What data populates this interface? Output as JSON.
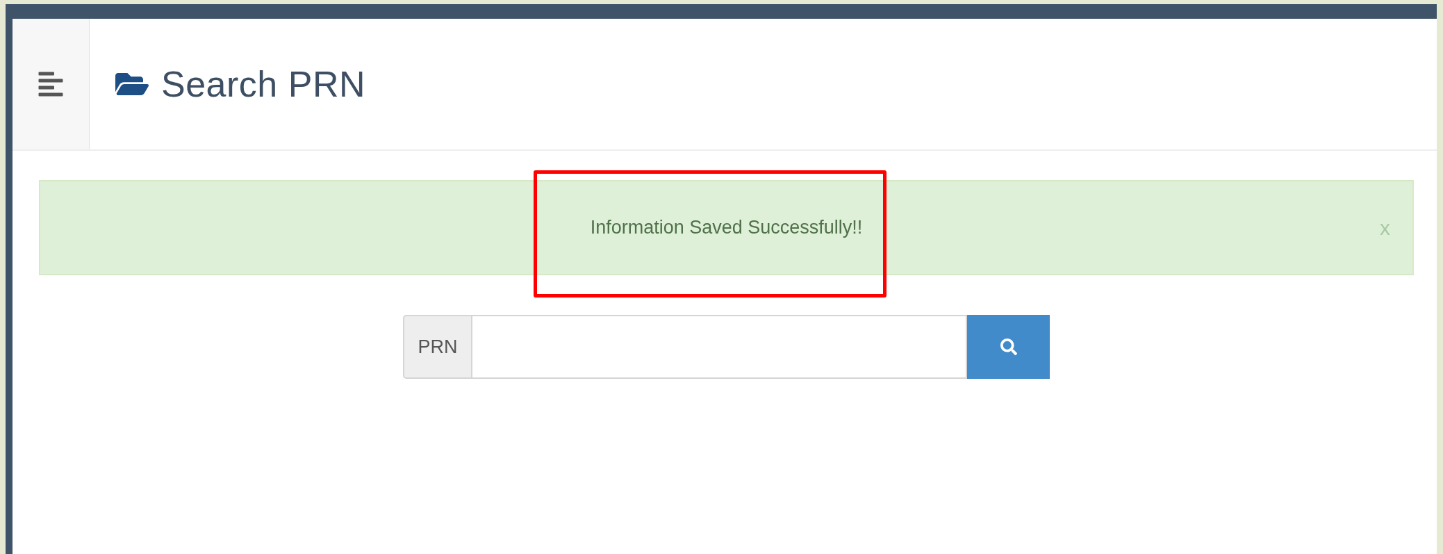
{
  "header": {
    "title": "Search PRN"
  },
  "alert": {
    "message": "Information Saved Successfully!!",
    "close": "x"
  },
  "search": {
    "addon": "PRN"
  }
}
